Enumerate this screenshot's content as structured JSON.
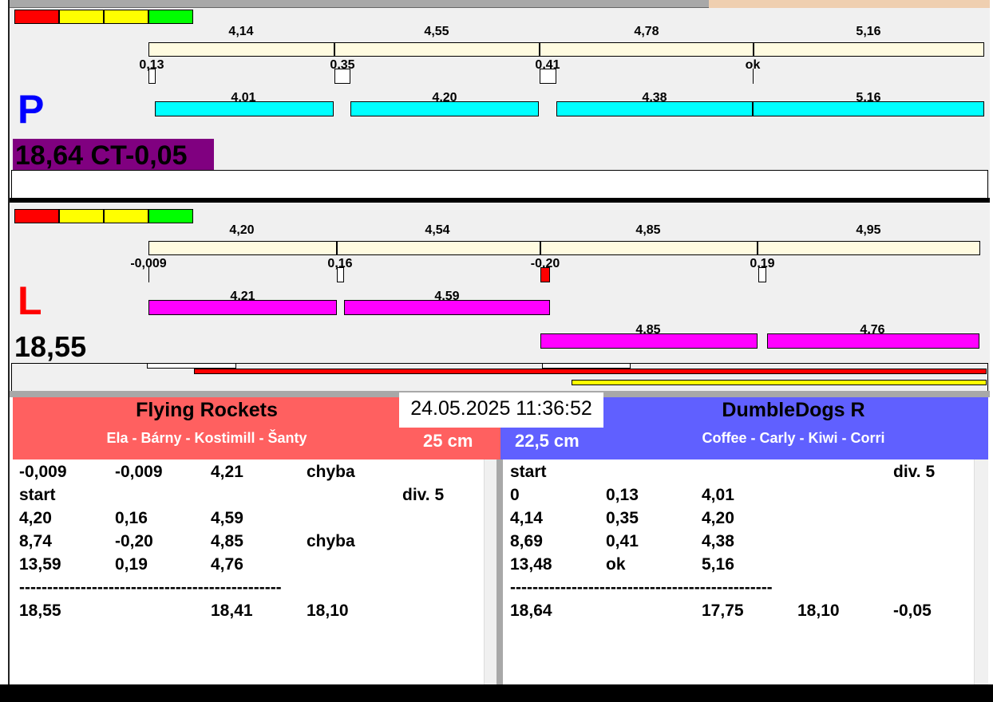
{
  "colors": {
    "red": "#ff0000",
    "yellow": "#ffff00",
    "green": "#00ff00",
    "cyan": "#00ffff",
    "magenta": "#ff00ff",
    "purple": "#800080",
    "team_left": "#ff6060",
    "team_right": "#6060ff"
  },
  "p": {
    "letter": "P",
    "top_times": [
      "4,14",
      "4,55",
      "4,78",
      "5,16"
    ],
    "gaps": [
      "0,13",
      "0,35",
      "0,41",
      "ok"
    ],
    "run_times": [
      "4,01",
      "4,20",
      "4,38",
      "5,16"
    ],
    "total": "18,64 CT-0,05"
  },
  "l": {
    "letter": "L",
    "top_times": [
      "4,20",
      "4,54",
      "4,85",
      "4,95"
    ],
    "gaps": [
      "-0,009",
      "0,16",
      "-0,20",
      "0,19"
    ],
    "run_times": [
      "4,21",
      "4,59",
      "4,85",
      "4,76"
    ],
    "total": "18,55"
  },
  "datetime": "24.05.2025 11:36:52",
  "left_team": {
    "name": "Flying Rockets",
    "members": "Ela - Bárny - Kostimill - Šanty",
    "height": "25 cm",
    "rows": [
      [
        "-0,009",
        "-0,009",
        "4,21",
        "chyba",
        ""
      ],
      [
        "start",
        "",
        "",
        "",
        "div.  5"
      ],
      [
        "4,20",
        "0,16",
        "4,59",
        "",
        ""
      ],
      [
        "8,74",
        "-0,20",
        "4,85",
        "chyba",
        ""
      ],
      [
        "13,59",
        "0,19",
        "4,76",
        "",
        ""
      ],
      [
        "-----------------------------------------------",
        "",
        "",
        "",
        ""
      ],
      [
        "18,55",
        "",
        "18,41",
        "18,10",
        ""
      ]
    ]
  },
  "right_team": {
    "name": "DumbleDogs R",
    "members": "Coffee - Carly - Kiwi - Corri",
    "height": "22,5 cm",
    "rows": [
      [
        "start",
        "",
        "",
        "",
        "div.  5"
      ],
      [
        "0",
        "0,13",
        "4,01",
        "",
        ""
      ],
      [
        "4,14",
        "0,35",
        "4,20",
        "",
        ""
      ],
      [
        "8,69",
        "0,41",
        "4,38",
        "",
        ""
      ],
      [
        "13,48",
        "ok",
        "5,16",
        "",
        ""
      ],
      [
        "-----------------------------------------------",
        "",
        "",
        "",
        ""
      ],
      [
        "18,64",
        "",
        "17,75",
        "18,10",
        "-0,05"
      ]
    ]
  }
}
